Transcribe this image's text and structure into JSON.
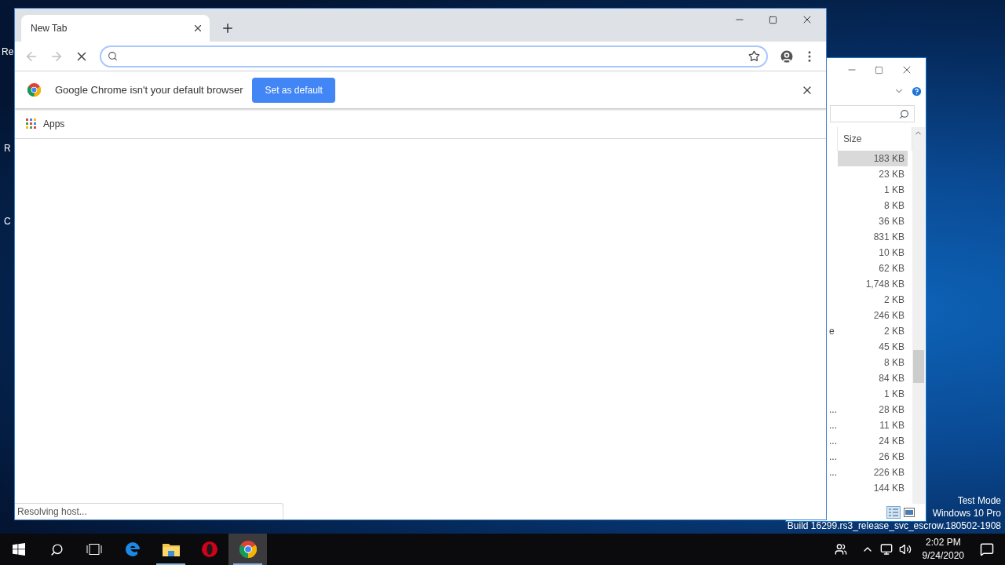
{
  "desktop": {
    "labels": [
      "Re",
      "R",
      "C"
    ],
    "info_lines": [
      "Test Mode",
      "Windows 10 Pro",
      "Build 16299.rs3_release_svc_escrow.180502-1908"
    ]
  },
  "explorer": {
    "column": "Size",
    "rows": [
      {
        "size": "183 KB",
        "selected": true
      },
      {
        "size": "23 KB",
        "selected": false
      },
      {
        "size": "1 KB",
        "selected": false
      },
      {
        "size": "8 KB",
        "selected": false
      },
      {
        "size": "36 KB",
        "selected": false
      },
      {
        "size": "831 KB",
        "selected": false
      },
      {
        "size": "10 KB",
        "selected": false
      },
      {
        "size": "62 KB",
        "selected": false
      },
      {
        "size": "1,748 KB",
        "selected": false
      },
      {
        "size": "2 KB",
        "selected": false
      },
      {
        "size": "246 KB",
        "selected": false
      },
      {
        "name": "e",
        "size": "2 KB",
        "selected": false
      },
      {
        "size": "45 KB",
        "selected": false
      },
      {
        "size": "8 KB",
        "selected": false
      },
      {
        "size": "84 KB",
        "selected": false
      },
      {
        "size": "1 KB",
        "selected": false
      },
      {
        "name": "...",
        "size": "28 KB",
        "selected": false
      },
      {
        "name": "...",
        "size": "11 KB",
        "selected": false
      },
      {
        "name": "...",
        "size": "24 KB",
        "selected": false
      },
      {
        "name": "...",
        "size": "26 KB",
        "selected": false
      },
      {
        "name": "...",
        "size": "226 KB",
        "selected": false
      },
      {
        "size": "144 KB",
        "selected": false
      }
    ]
  },
  "browser": {
    "tabs": [
      {
        "title": "New Tab",
        "selected": true
      }
    ],
    "back_disabled": true,
    "forward_disabled": true,
    "loading": true,
    "infobar": {
      "message": "Google Chrome isn't your default browser",
      "button": "Set as default"
    },
    "bookmarks": [
      {
        "label": "Apps"
      }
    ],
    "status": "Resolving host..."
  },
  "taskbar": {
    "apps": [
      {
        "kind": "edge",
        "selected": false
      },
      {
        "kind": "files",
        "selected": false
      },
      {
        "kind": "opera",
        "selected": false
      },
      {
        "kind": "chrome",
        "selected": true
      }
    ],
    "clock": {
      "time": "2:02 PM",
      "date": "9/24/2020"
    }
  }
}
